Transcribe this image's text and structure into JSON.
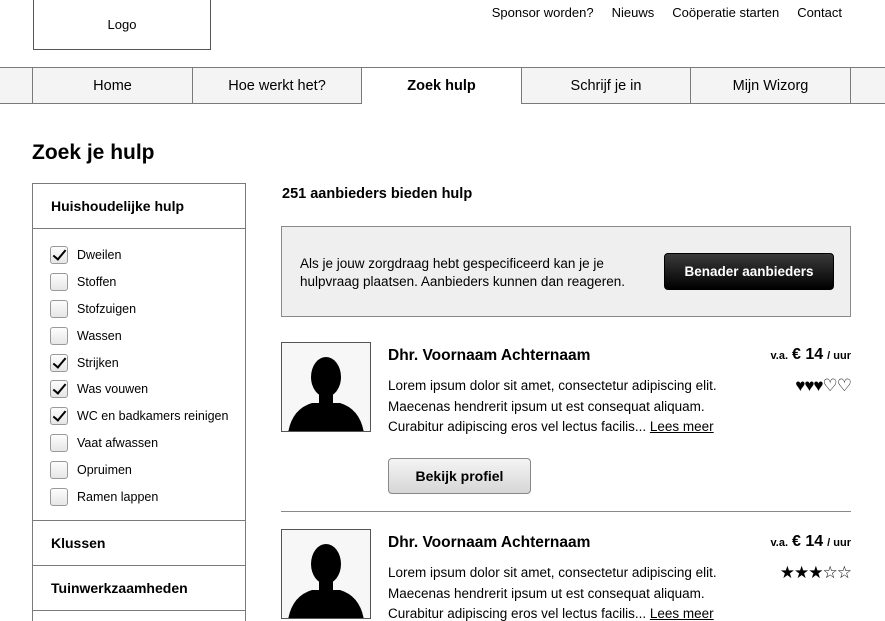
{
  "header": {
    "logo": "Logo",
    "links": [
      "Sponsor worden?",
      "Nieuws",
      "Coöperatie starten",
      "Contact"
    ]
  },
  "nav": {
    "items": [
      {
        "label": "Home",
        "active": false
      },
      {
        "label": "Hoe werkt het?",
        "active": false
      },
      {
        "label": "Zoek hulp",
        "active": true
      },
      {
        "label": "Schrijf je in",
        "active": false
      },
      {
        "label": "Mijn Wizorg",
        "active": false
      }
    ]
  },
  "page_title": "Zoek je hulp",
  "filters": {
    "category": "Huishoudelijke hulp",
    "options": [
      {
        "label": "Dweilen",
        "checked": true
      },
      {
        "label": "Stoffen",
        "checked": false
      },
      {
        "label": "Stofzuigen",
        "checked": false
      },
      {
        "label": "Wassen",
        "checked": false
      },
      {
        "label": "Strijken",
        "checked": true
      },
      {
        "label": "Was vouwen",
        "checked": true
      },
      {
        "label": "WC en badkamers reinigen",
        "checked": true
      },
      {
        "label": "Vaat afwassen",
        "checked": false
      },
      {
        "label": "Opruimen",
        "checked": false
      },
      {
        "label": "Ramen lappen",
        "checked": false
      }
    ],
    "other_categories": [
      "Klussen",
      "Tuinwerkzaamheden"
    ]
  },
  "results": {
    "count_text": "251 aanbieders bieden hulp",
    "callout_text": "Als je jouw zorgdraag hebt gespecificeerd kan je je hulpvraag plaatsen. Aanbieders kunnen dan reageren.",
    "callout_button": "Benader aanbieders",
    "providers": [
      {
        "name": "Dhr. Voornaam Achternaam",
        "price_prefix": "v.a.",
        "price": "€ 14",
        "price_unit": "/ uur",
        "description": "Lorem ipsum dolor sit amet, consectetur adipiscing elit. Maecenas hendrerit ipsum ut est consequat aliquam. Curabitur adipiscing eros vel lectus facilis...",
        "more_link": "Lees meer",
        "rating_icon": "heart",
        "rating": 3,
        "rating_max": 5,
        "button": "Bekijk profiel"
      },
      {
        "name": "Dhr. Voornaam Achternaam",
        "price_prefix": "v.a.",
        "price": "€ 14",
        "price_unit": "/ uur",
        "description": "Lorem ipsum dolor sit amet, consectetur adipiscing elit. Maecenas hendrerit ipsum ut est consequat aliquam. Curabitur adipiscing eros vel lectus facilis...",
        "more_link": "Lees meer",
        "rating_icon": "star",
        "rating": 3,
        "rating_max": 5
      }
    ]
  }
}
